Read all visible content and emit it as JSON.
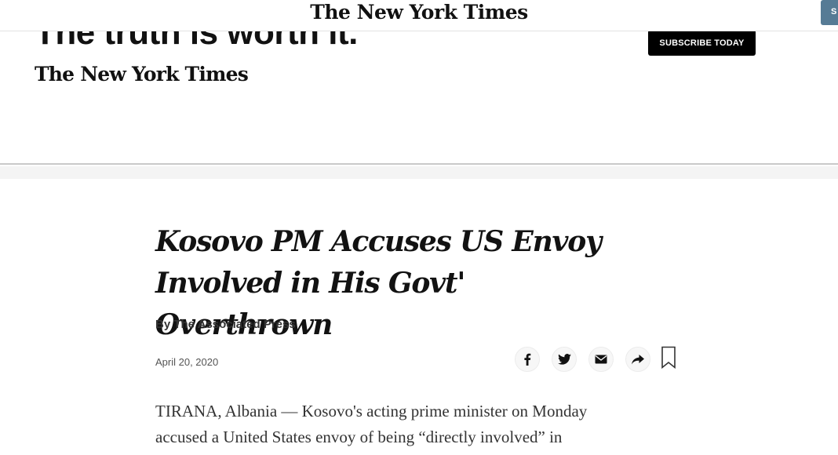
{
  "topbar": {
    "logo": "The New York Times",
    "cta_label": "S"
  },
  "ad": {
    "slogan": "The truth is worth it.",
    "logo": "The New York Times",
    "subscribe_label": "SUBSCRIBE TODAY"
  },
  "article": {
    "headline_line1": "Kosovo PM Accuses US Envoy",
    "headline_line2": "Involved in His Govt' Overthrown",
    "byline": "By The Associated Press",
    "date": "April 20, 2020",
    "body_line1": "TIRANA, Albania — Kosovo's acting prime minister on Monday",
    "body_line2": "accused a United States envoy of being “directly involved” in"
  },
  "share": {
    "icons": [
      "facebook-icon",
      "twitter-icon",
      "email-icon",
      "share-icon",
      "bookmark-icon"
    ]
  }
}
